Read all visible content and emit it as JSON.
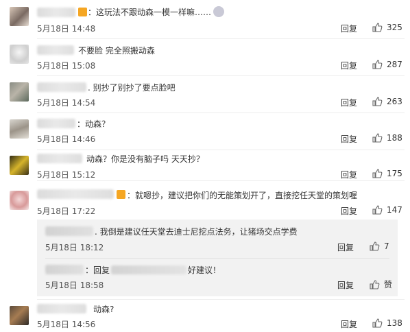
{
  "comments": [
    {
      "text": "：这玩法不跟动森一模一样嘛……",
      "time": "5月18日 14:48",
      "reply": "回复",
      "likes": "325"
    },
    {
      "text": "不要脸 完全照搬动森",
      "time": "5月18日 15:08",
      "reply": "回复",
      "likes": "287"
    },
    {
      "text": "别抄了别抄了要点脸吧",
      "time": "5月18日 14:54",
      "reply": "回复",
      "likes": "263"
    },
    {
      "text": "：动森？",
      "time": "5月18日 14:46",
      "reply": "回复",
      "likes": "188"
    },
    {
      "text": "动森？你是没有脑子吗 天天抄？",
      "time": "5月18日 15:12",
      "reply": "回复",
      "likes": "175"
    },
    {
      "text": "：就嗯抄，建议把你们的无能策划开了，直接挖任天堂的策划喔",
      "time": "5月18日 17:22",
      "reply": "回复",
      "likes": "147"
    },
    {
      "text": "动森?",
      "time": "5月18日 14:56",
      "reply": "回复",
      "likes": "138"
    }
  ],
  "subreplies": [
    {
      "text": "我倒是建议任天堂去迪士尼挖点法务，让猪场交点学费",
      "time": "5月18日 18:12",
      "reply": "回复",
      "likes": "7"
    },
    {
      "text_prefix": "：回复",
      "text_suffix": "好建议！",
      "time": "5月18日 18:58",
      "reply": "回复",
      "likes": "赞"
    }
  ],
  "icons": {
    "like": "thumbs-up-icon",
    "vip": "vip-badge-icon",
    "emoji": "emoji-icon"
  }
}
